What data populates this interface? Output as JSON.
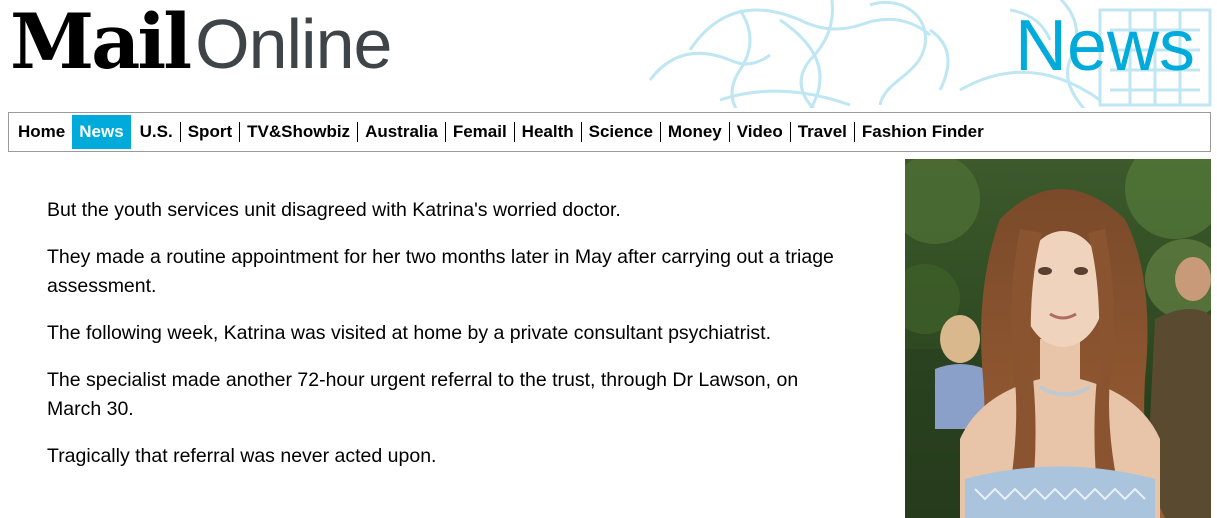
{
  "header": {
    "logo_mail": "Mail",
    "logo_online": "Online",
    "section_title": "News"
  },
  "colors": {
    "accent": "#00aadb",
    "logo_grey": "#3e4447",
    "nav_border": "#9b9b9b"
  },
  "nav": {
    "items": [
      {
        "label": "Home"
      },
      {
        "label": "News",
        "active": true
      },
      {
        "label": "U.S."
      },
      {
        "label": "Sport"
      },
      {
        "label": "TV&Showbiz"
      },
      {
        "label": "Australia"
      },
      {
        "label": "Femail"
      },
      {
        "label": "Health"
      },
      {
        "label": "Science"
      },
      {
        "label": "Money"
      },
      {
        "label": "Video"
      },
      {
        "label": "Travel"
      },
      {
        "label": "Fashion Finder"
      }
    ]
  },
  "article": {
    "paragraphs": [
      "But the youth services unit disagreed with Katrina's worried doctor.",
      "They made a routine appointment for her two months later in May after carrying out a triage assessment.",
      "The following week, Katrina was visited at home by a private consultant psychiatrist.",
      "The specialist made another 72-hour urgent referral to the trust, through Dr Lawson, on March 30.",
      "Tragically that referral was never acted upon."
    ]
  }
}
